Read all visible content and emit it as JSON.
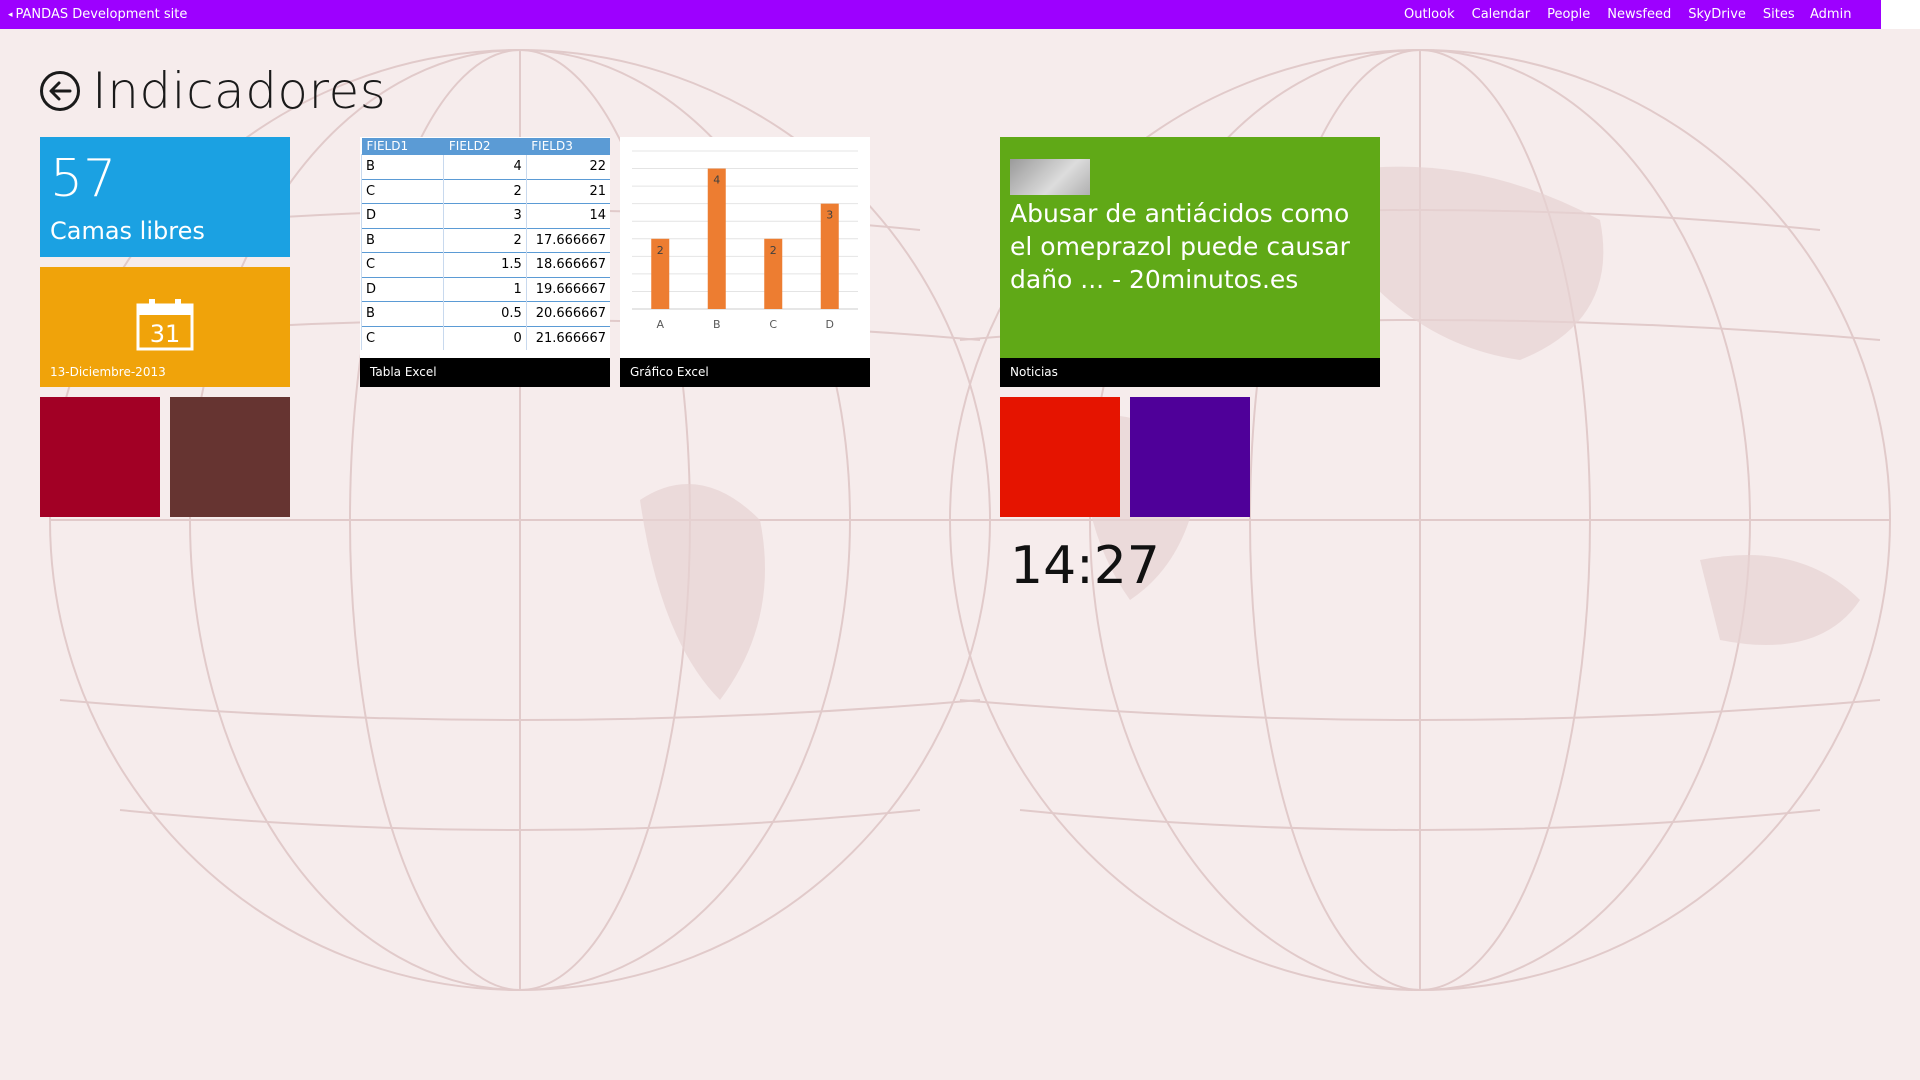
{
  "suitebar": {
    "site_name": "PANDAS Development site",
    "links": [
      "Outlook",
      "Calendar",
      "People",
      "Newsfeed",
      "SkyDrive",
      "Sites"
    ],
    "user": "Admin",
    "color": "#9d00ff"
  },
  "page": {
    "title": "Indicadores",
    "back_icon": "arrow-left-circle-icon"
  },
  "tiles": {
    "camas": {
      "value": "57",
      "label": "Camas libres",
      "color": "#1ba1e2"
    },
    "fecha": {
      "icon": "calendar-icon",
      "day": "31",
      "label": "13-Diciembre-2013",
      "color": "#f0a30a"
    },
    "crimson": {
      "color": "#a20025"
    },
    "brown": {
      "color": "#663431"
    },
    "tabla": {
      "caption": "Tabla Excel",
      "columns": [
        "FIELD1",
        "FIELD2",
        "FIELD3"
      ],
      "rows": [
        [
          "B",
          "4",
          "22"
        ],
        [
          "C",
          "2",
          "21"
        ],
        [
          "D",
          "3",
          "14"
        ],
        [
          "B",
          "2",
          "17.666667"
        ],
        [
          "C",
          "1.5",
          "18.666667"
        ],
        [
          "D",
          "1",
          "19.666667"
        ],
        [
          "B",
          "0.5",
          "20.666667"
        ],
        [
          "C",
          "0",
          "21.666667"
        ]
      ]
    },
    "grafico": {
      "caption": "Gráfico Excel"
    },
    "noticias": {
      "caption": "Noticias",
      "headline": "Abusar de antiácidos como el omeprazol puede causar daño ... - 20minutos.es",
      "color": "#60a917"
    },
    "red": {
      "color": "#e51400"
    },
    "indigo": {
      "color": "#4f0099"
    }
  },
  "clock": {
    "time": "14:27"
  },
  "chart_data": {
    "type": "bar",
    "categories": [
      "A",
      "B",
      "C",
      "D"
    ],
    "values": [
      2,
      4,
      2,
      3
    ],
    "ylim": [
      0,
      4.5
    ],
    "grid": true,
    "bar_color": "#ed7d31"
  }
}
